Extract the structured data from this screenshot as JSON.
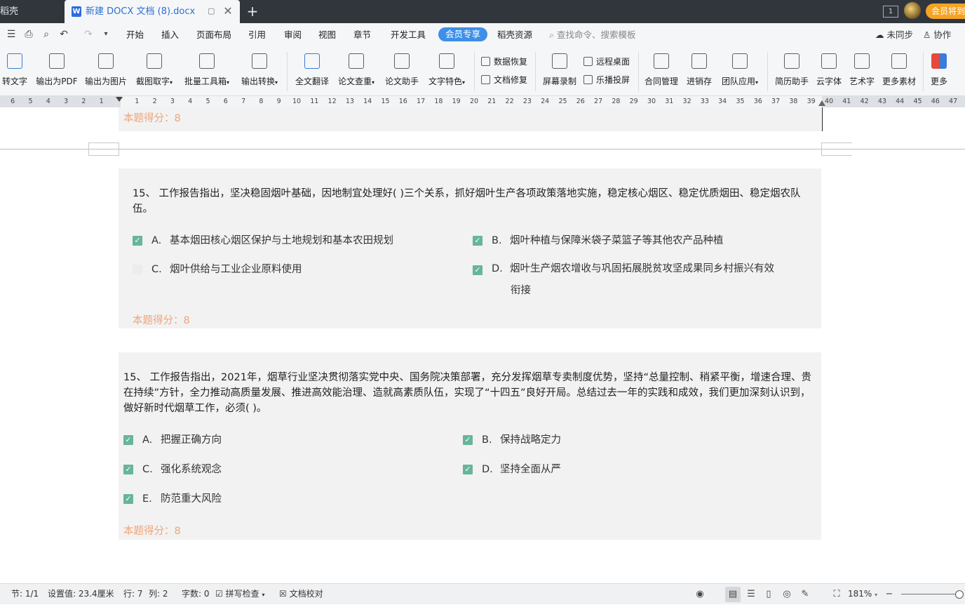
{
  "tabbar": {
    "left_tab_text": "稻壳",
    "active_tab_title": "新建 DOCX 文档 (8).docx",
    "doc_icon_letter": "W",
    "min_glyph": "▢",
    "close_glyph": "✕",
    "plus_glyph": "+",
    "window_count": "1",
    "vip_label": "会员将到期"
  },
  "menubar": {
    "items": [
      "开始",
      "插入",
      "页面布局",
      "引用",
      "审阅",
      "视图",
      "章节",
      "开发工具"
    ],
    "vip_tab": "会员专享",
    "resource_tab": "稻壳资源",
    "search_placeholder": "查找命令、搜索模板",
    "sync_label": "未同步",
    "collab_label": "协作"
  },
  "ribbon": {
    "buttons": [
      {
        "label": "转文字"
      },
      {
        "label": "输出为PDF"
      },
      {
        "label": "输出为图片"
      },
      {
        "label": "截图取字"
      },
      {
        "label": "批量工具箱"
      },
      {
        "label": "输出转换"
      },
      {
        "label": "全文翻译"
      },
      {
        "label": "论文查重"
      },
      {
        "label": "论文助手"
      },
      {
        "label": "文字特色"
      },
      {
        "label": "屏幕录制"
      },
      {
        "label": "合同管理"
      },
      {
        "label": "进销存"
      },
      {
        "label": "团队应用"
      },
      {
        "label": "简历助手"
      },
      {
        "label": "云字体"
      },
      {
        "label": "艺术字"
      },
      {
        "label": "更多素材"
      },
      {
        "label": "更多"
      }
    ],
    "small": {
      "data_recover": "数据恢复",
      "doc_repair": "文档修复",
      "remote_desktop": "远程桌面",
      "cast_screen": "乐播投屏"
    }
  },
  "ruler": {
    "left_ticks": [
      "6",
      "5",
      "4",
      "3",
      "2",
      "1"
    ],
    "right_ticks": [
      "1",
      "2",
      "3",
      "4",
      "5",
      "6",
      "7",
      "8",
      "9",
      "10",
      "11",
      "12",
      "13",
      "14",
      "15",
      "16",
      "17",
      "18",
      "19",
      "20",
      "21",
      "22",
      "23",
      "24",
      "25",
      "26",
      "27",
      "28",
      "29",
      "30",
      "31",
      "32",
      "33",
      "34",
      "35",
      "36",
      "37",
      "38",
      "39",
      "40",
      "41",
      "42",
      "43",
      "44",
      "45",
      "46",
      "47"
    ]
  },
  "document": {
    "prev_score": "本题得分：8",
    "q1": {
      "text": "15、 工作报告指出，坚决稳固烟叶基础，因地制宜处理好( )三个关系，抓好烟叶生产各项政策落地实施，稳定核心烟区、稳定优质烟田、稳定烟农队伍。",
      "options": [
        {
          "letter": "A.",
          "text": "基本烟田核心烟区保护与土地规划和基本农田规划",
          "checked": true
        },
        {
          "letter": "B.",
          "text": "烟叶种植与保障米袋子菜篮子等其他农产品种植",
          "checked": true
        },
        {
          "letter": "C.",
          "text": "烟叶供给与工业企业原料使用",
          "checked": false
        },
        {
          "letter": "D.",
          "text": "烟叶生产烟农增收与巩固拓展脱贫攻坚成果同乡村振兴有效",
          "text2": "衔接",
          "checked": true
        }
      ],
      "score": "本题得分：8"
    },
    "q2": {
      "text": "15、 工作报告指出，2021年，烟草行业坚决贯彻落实党中央、国务院决策部署，充分发挥烟草专卖制度优势，坚持“总量控制、稍紧平衡，增速合理、贵在持续”方针，全力推动高质量发展、推进高效能治理、造就高素质队伍，实现了“十四五”良好开局。总结过去一年的实践和成效，我们更加深刻认识到，做好新时代烟草工作，必须( )。",
      "options": [
        {
          "letter": "A.",
          "text": "把握正确方向",
          "checked": true
        },
        {
          "letter": "B.",
          "text": "保持战略定力",
          "checked": true
        },
        {
          "letter": "C.",
          "text": "强化系统观念",
          "checked": true
        },
        {
          "letter": "D.",
          "text": "坚持全面从严",
          "checked": true
        },
        {
          "letter": "E.",
          "text": "防范重大风险",
          "checked": true
        }
      ],
      "score": "本题得分：8"
    },
    "check_glyph": "✓"
  },
  "statusbar": {
    "section": "节: 1/1",
    "setting": "设置值: 23.4厘米",
    "row": "行: 7",
    "col": "列: 2",
    "wordcount": "字数: 0",
    "spellcheck": "拼写检查",
    "doc_proof": "文档校对",
    "zoom": "181%"
  }
}
